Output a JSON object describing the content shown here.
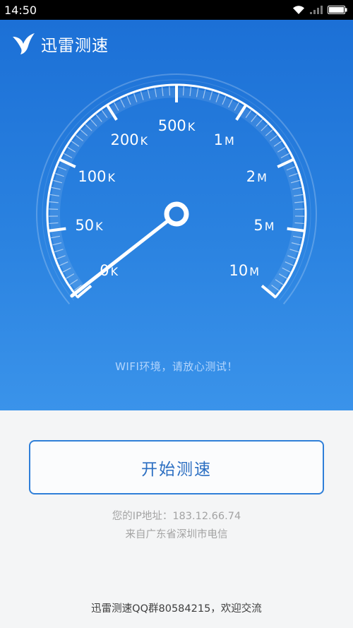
{
  "status_bar": {
    "time": "14:50",
    "icons": [
      "wifi-icon",
      "signal-icon",
      "battery-icon"
    ]
  },
  "app": {
    "title": "迅雷测速",
    "logo_icon": "bird-logo-icon"
  },
  "gauge": {
    "labels": [
      {
        "value": "0",
        "unit": "K"
      },
      {
        "value": "50",
        "unit": "K"
      },
      {
        "value": "100",
        "unit": "K"
      },
      {
        "value": "200",
        "unit": "K"
      },
      {
        "value": "500",
        "unit": "K"
      },
      {
        "value": "1",
        "unit": "M"
      },
      {
        "value": "2",
        "unit": "M"
      },
      {
        "value": "5",
        "unit": "M"
      },
      {
        "value": "10",
        "unit": "M"
      }
    ],
    "needle_value": "0K",
    "colors": {
      "background_top": "#1c70d6",
      "background_bottom": "#3a93ea",
      "dial": "#ffffff"
    }
  },
  "hint": "WIFI环境，请放心测试！",
  "start_button": {
    "label": "开始测速",
    "color": "#2f7fd8"
  },
  "ip_info": {
    "ip_line": "您的IP地址：183.12.66.74",
    "location_line": "来自广东省深圳市电信"
  },
  "footer": "迅雷测速QQ群80584215，欢迎交流"
}
